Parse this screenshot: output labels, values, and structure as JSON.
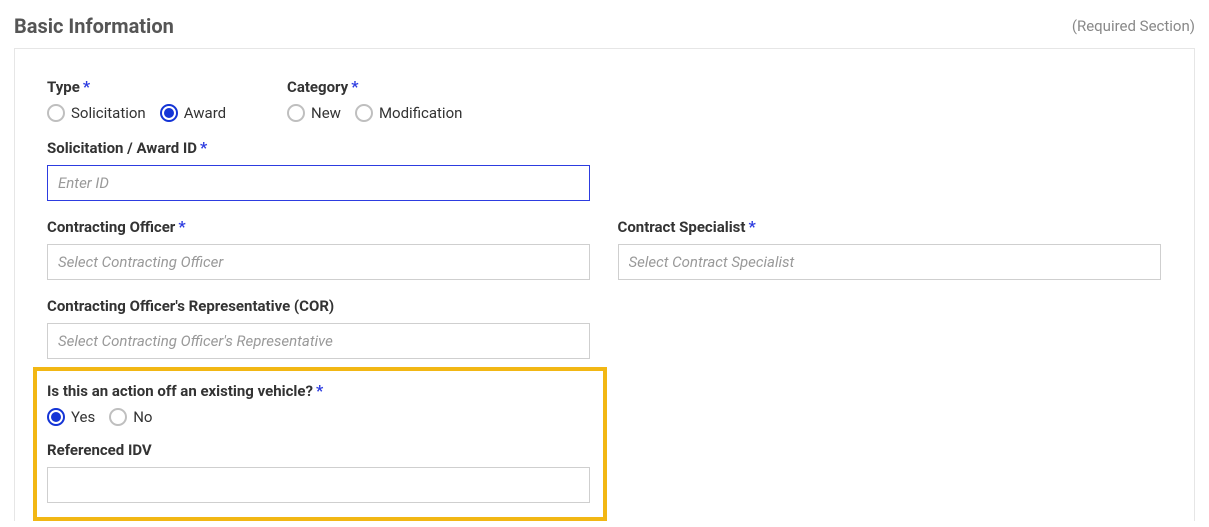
{
  "header": {
    "title": "Basic Information",
    "required_label": "(Required Section)"
  },
  "type_section": {
    "label": "Type",
    "options": {
      "solicitation": "Solicitation",
      "award": "Award"
    }
  },
  "category_section": {
    "label": "Category",
    "options": {
      "new": "New",
      "modification": "Modification"
    }
  },
  "id_section": {
    "label": "Solicitation / Award ID",
    "placeholder": "Enter ID",
    "value": ""
  },
  "co_section": {
    "label": "Contracting Officer",
    "placeholder": "Select Contracting Officer"
  },
  "cs_section": {
    "label": "Contract Specialist",
    "placeholder": "Select Contract Specialist"
  },
  "cor_section": {
    "label": "Contracting Officer's Representative (COR)",
    "placeholder": "Select Contracting Officer's Representative"
  },
  "vehicle_section": {
    "label": "Is this an action off an existing vehicle?",
    "options": {
      "yes": "Yes",
      "no": "No"
    }
  },
  "idv_section": {
    "label": "Referenced IDV",
    "value": ""
  },
  "star": "*"
}
